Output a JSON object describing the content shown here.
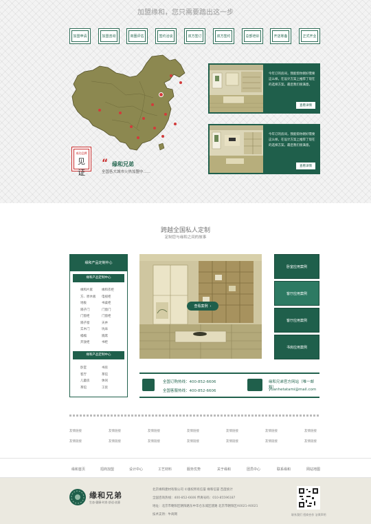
{
  "top": {
    "title": "加盟缘和，您只需要踏出这一步",
    "steps": [
      "加盟申请",
      "加盟咨询",
      "商圈评估",
      "签约洽谈",
      "双方签订",
      "双方签约",
      "总部培训",
      "开店筹备",
      "正式开业"
    ],
    "stamp_small": "成功品牌",
    "stamp_big": "见证",
    "brand": "缘和兄弟",
    "brand_sub": "全国各大城市火热加盟中......",
    "cases": [
      {
        "text": "今年订的房间，我能帮你刚好需要这么样，在设计方案上推荐了现在的选择方案，最后我们很满意。",
        "button": "查看详情"
      },
      {
        "text": "今年订的房间，我能帮你刚好需要这么样，在设计方案上推荐了现在的选择方案，最后我们很满意。",
        "button": "查看详情"
      }
    ]
  },
  "section": {
    "title": "跨越全国私人定制",
    "subtitle": "定制您与缘和之间的故事"
  },
  "category": {
    "head": "缘和产品定制中心",
    "sub1": "缘和产品定制中心",
    "grid1": [
      "缘和片家",
      "缘和衣柜",
      "方、原木板",
      "电视柜",
      "地板",
      "书桌柜",
      "隔子门",
      "门窗门",
      "门窗柜",
      "门窗柜",
      "隔子窗",
      "天井",
      "实木门",
      "坑床",
      "榻榻",
      "隔席",
      "开放柜",
      "书柜"
    ],
    "sub2": "缘和产品定制中心",
    "grid2": [
      "卧室",
      "书房",
      "客厅",
      "茶馆",
      "儿童房",
      "休闲",
      "茶馆",
      "工装"
    ]
  },
  "showcase": {
    "view_button": "查看案例",
    "tabs": [
      "卧室应用案例",
      "客厅应用案例",
      "客厅应用案例",
      "书房应用案例"
    ]
  },
  "contact": {
    "phone1": "全国订购热线：400-852-6606",
    "phone2": "全国客服热线：400-852-6606",
    "email1": "缘和兄弟官方网站（唯一邮箱）",
    "email2": "yuanhetatami@mail.com"
  },
  "links": {
    "row1": [
      "友情链接",
      "友情链接",
      "友情链接",
      "友情链接",
      "友情链接",
      "友情链接",
      "友情链接"
    ],
    "row2": [
      "友情链接",
      "友情链接",
      "友情链接",
      "友情链接",
      "友情链接",
      "友情链接",
      "友情链接"
    ]
  },
  "bottom_nav": [
    "缘和首页",
    "招商加盟",
    "设计中心",
    "工艺材料",
    "服务优势",
    "关于缘和",
    "团员中心",
    "联系缘和",
    "网站地图"
  ],
  "footer": {
    "line1": "北京缘和建材有限公司  ©版权所有信誉  缘和信誉  百度统计",
    "line2": "全国咨询热线：400-852-6606    传真号码：010-85596187",
    "line3": "地址：北京市朝阳区朝阳路东中华仓东城区建路 北京市朝阳区A0021-A0021",
    "line4": "技术支持：牛商网",
    "right_text": "联系我们 招商合作 法律声明",
    "logo_text": "缘和兄弟",
    "logo_sub": "生态·健康·时尚·舒适·创意"
  }
}
